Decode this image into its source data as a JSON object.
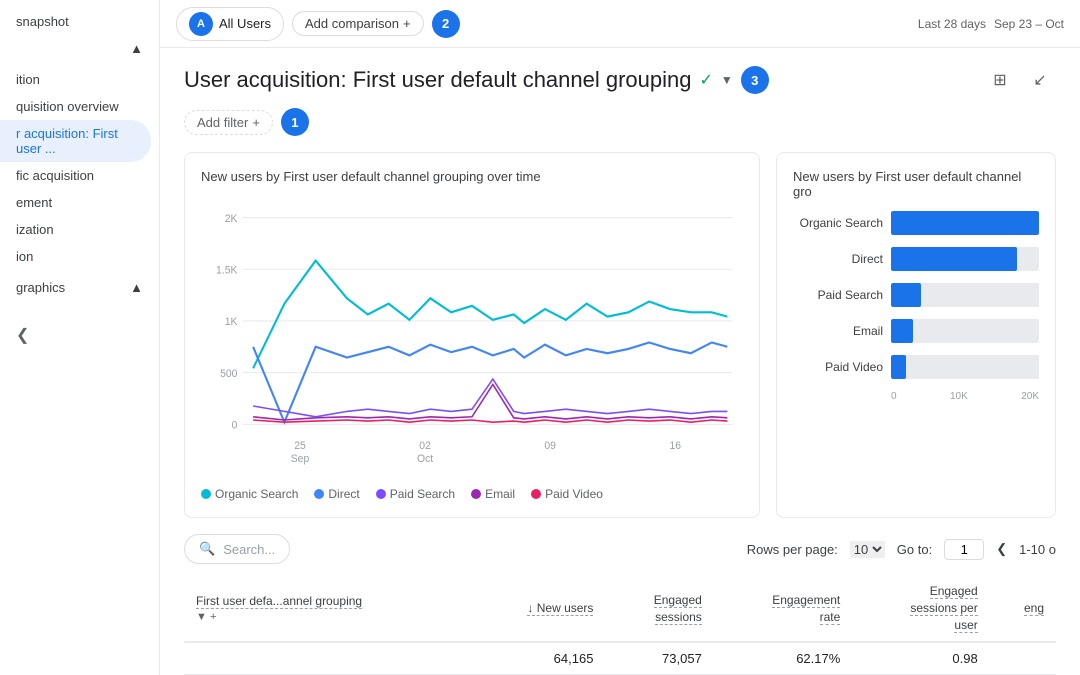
{
  "topbar": {
    "user_label": "All Users",
    "user_initial": "A",
    "add_comparison_label": "Add comparison",
    "badge2": "2",
    "badge3": "3",
    "date_range_label": "Last 28 days",
    "date_range": "Sep 23 – Oct"
  },
  "sidebar": {
    "title": "snapshot",
    "groups": [
      {
        "label": "",
        "items": [
          {
            "label": "ition",
            "active": false
          },
          {
            "label": "quisition overview",
            "active": false
          },
          {
            "label": "r acquisition: First user ...",
            "active": true
          },
          {
            "label": "fic acquisition",
            "active": false
          },
          {
            "label": "ement",
            "active": false
          },
          {
            "label": "ization",
            "active": false
          },
          {
            "label": "ion",
            "active": false
          }
        ]
      },
      {
        "label": "graphics",
        "items": []
      }
    ]
  },
  "page": {
    "title": "User acquisition: First user default channel grouping",
    "add_filter_label": "Add filter",
    "badge1": "1"
  },
  "line_chart": {
    "title": "New users by First user default channel grouping over time",
    "y_labels": [
      "2K",
      "1.5K",
      "1K",
      "500",
      "0"
    ],
    "x_labels": [
      "25\nSep",
      "02\nOct",
      "09",
      "16"
    ],
    "legend": [
      {
        "label": "Organic Search",
        "color": "#00bcd4"
      },
      {
        "label": "Direct",
        "color": "#4285f4"
      },
      {
        "label": "Paid Search",
        "color": "#7c4dff"
      },
      {
        "label": "Email",
        "color": "#9c27b0"
      },
      {
        "label": "Paid Video",
        "color": "#e91e63"
      }
    ]
  },
  "bar_chart": {
    "title": "New users by First user default channel gro",
    "items": [
      {
        "label": "Organic Search",
        "value": 100,
        "display": ""
      },
      {
        "label": "Direct",
        "value": 85,
        "display": ""
      },
      {
        "label": "Paid Search",
        "value": 20,
        "display": ""
      },
      {
        "label": "Email",
        "value": 15,
        "display": ""
      },
      {
        "label": "Paid Video",
        "value": 10,
        "display": ""
      }
    ],
    "axis_labels": [
      "0",
      "10K",
      "20K"
    ]
  },
  "table": {
    "search_placeholder": "Search...",
    "rows_label": "Rows per page:",
    "rows_value": "10",
    "goto_label": "Go to:",
    "goto_value": "1",
    "page_range": "1-10 o",
    "columns": [
      {
        "label": "First user defa...annel grouping",
        "align": "left"
      },
      {
        "label": "New users",
        "align": "right",
        "sort": "↓"
      },
      {
        "label": "Engaged\nsessions",
        "align": "right"
      },
      {
        "label": "Engagement\nrate",
        "align": "right"
      },
      {
        "label": "Engaged\nsessions per\nuser",
        "align": "right"
      },
      {
        "label": "eng",
        "align": "right"
      }
    ],
    "rows": [
      {
        "channel": "",
        "new_users": "64,165",
        "engaged_sessions": "73,057",
        "engagement_rate": "62.17%",
        "sessions_per_user": "0.98"
      }
    ]
  }
}
